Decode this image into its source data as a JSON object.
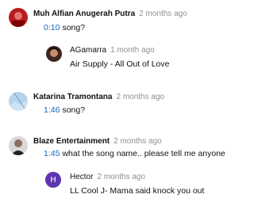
{
  "comments": [
    {
      "author": "Muh Alfian Anugerah Putra",
      "time": "2 months ago",
      "timestamp": "0:10",
      "text": "song?",
      "avatar": "red-avatar-icon"
    },
    {
      "author": "AGamarra",
      "time": "1 month ago",
      "text": "Air Supply - All Out of Love",
      "avatar": "photo-avatar-icon",
      "reply": true
    },
    {
      "author": "Katarina Tramontana",
      "time": "2 months ago",
      "timestamp": "1:46",
      "text": "song?",
      "avatar": "sky-avatar-icon"
    },
    {
      "author": "Blaze Entertainment",
      "time": "2 months ago",
      "timestamp": "1:45",
      "text": "what the song name.. please tell me anyone",
      "avatar": "portrait-avatar-icon"
    },
    {
      "author": "Hector",
      "time": "2 months ago",
      "text": "LL Cool J- Mama said knock you out",
      "avatar_letter": "H",
      "avatar_color": "#5e35b1",
      "reply": true
    }
  ]
}
